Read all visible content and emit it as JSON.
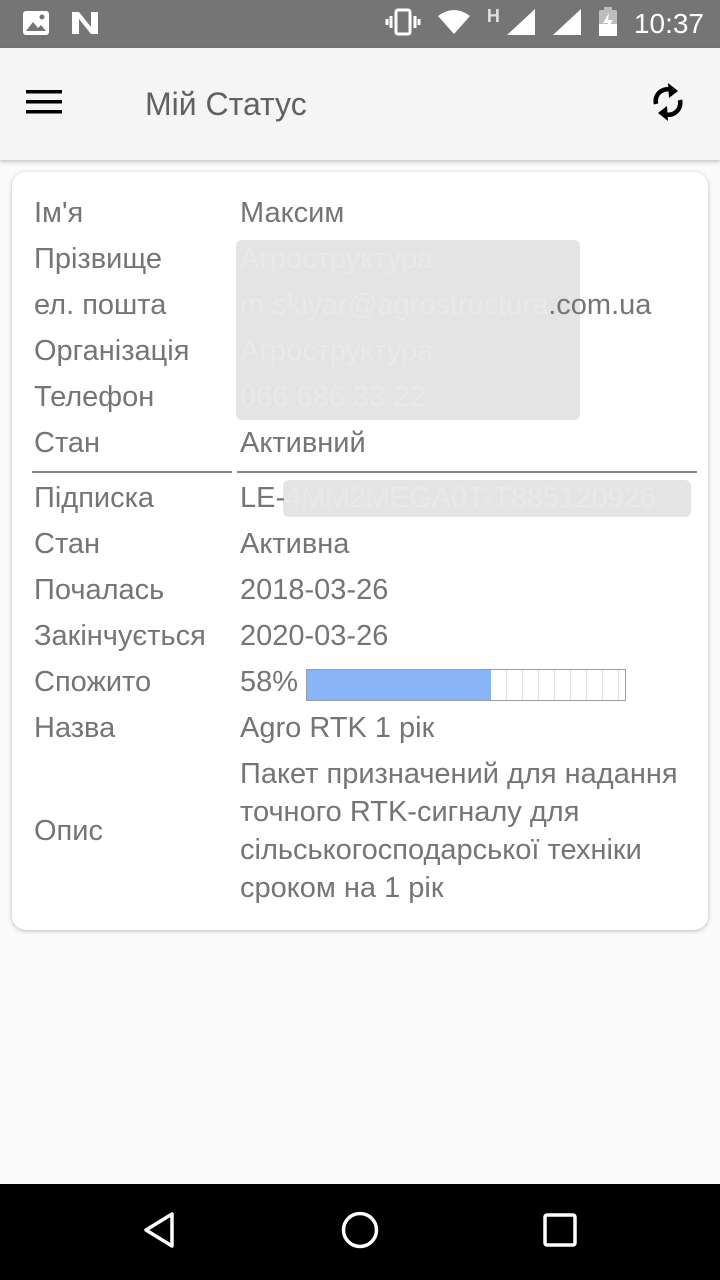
{
  "status_bar": {
    "time": "10:37",
    "network_letter": "H",
    "icons": [
      "image-icon",
      "n-app-icon",
      "vibrate-icon",
      "wifi-icon",
      "signal-icon",
      "signal-icon",
      "battery-icon"
    ]
  },
  "app_bar": {
    "title": "Мій Статус",
    "menu_icon": "hamburger-menu-icon",
    "refresh_icon": "sync-icon"
  },
  "profile": {
    "name_label": "Ім'я",
    "name_value": "Максим",
    "surname_label": "Прізвище",
    "surname_value": "Агроструктура",
    "email_label": "ел. пошта",
    "email_value_prefix": "m.skiyar@agrostructura",
    "email_value_suffix": ".com.ua",
    "org_label": "Організація",
    "org_value": "Агроструктура",
    "phone_label": "Телефон",
    "phone_value": "066 686 33 22",
    "state_label": "Стан",
    "state_value": "Активний"
  },
  "subscription": {
    "sub_label": "Підписка",
    "sub_value_prefix": "LE-",
    "sub_value_hidden": "4MM2MEGA0T-T885120926",
    "state_label": "Стан",
    "state_value": "Активна",
    "started_label": "Почалась",
    "started_value": "2018-03-26",
    "ends_label": "Закінчується",
    "ends_value": "2020-03-26",
    "consumed_label": "Спожито",
    "consumed_text": "58%",
    "consumed_fraction": 0.58,
    "name_label": "Назва",
    "name_value": "Agro RTK 1 рік",
    "desc_label": "Опис",
    "desc_value": "Пакет призначений для надання точного RTK-сигналу для сільськогосподарської техніки сроком на 1 рік"
  },
  "colors": {
    "progress_fill": "#8ab4f8",
    "status_bar": "#757575",
    "nav_bar": "#000000"
  }
}
